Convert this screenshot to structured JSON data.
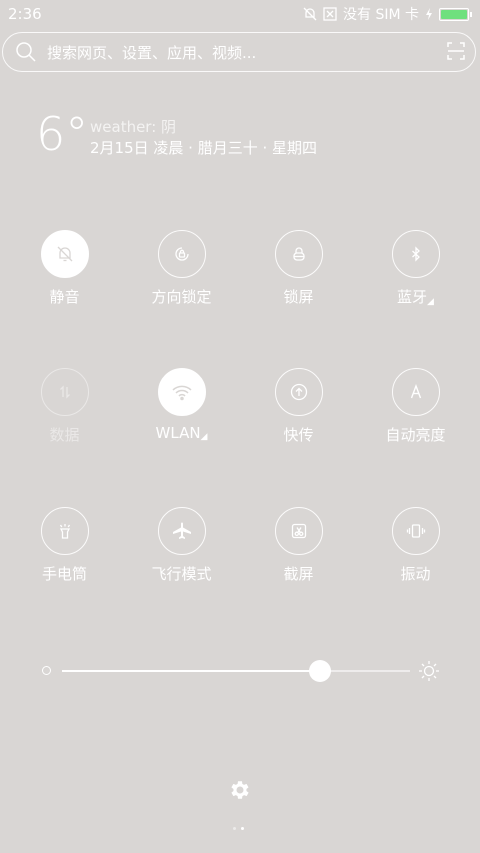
{
  "status": {
    "time": "2:36",
    "sim_text": "没有 SIM 卡",
    "battery_level": 1.0,
    "battery_color": "#6fe07e"
  },
  "search": {
    "placeholder": "搜索网页、设置、应用、视频..."
  },
  "weather": {
    "temp": "6°",
    "desc": "weather: 阴",
    "date": "2月15日 凌晨 · 腊月三十 · 星期四"
  },
  "tiles": [
    {
      "label": "静音",
      "icon": "bell-off-icon",
      "state": "active"
    },
    {
      "label": "方向锁定",
      "icon": "rotation-lock-icon",
      "state": "off"
    },
    {
      "label": "锁屏",
      "icon": "lock-icon",
      "state": "off"
    },
    {
      "label": "蓝牙",
      "icon": "bluetooth-icon",
      "state": "off",
      "has_arrow": true
    },
    {
      "label": "数据",
      "icon": "data-icon",
      "state": "disabled"
    },
    {
      "label": "WLAN",
      "icon": "wifi-icon",
      "state": "active",
      "has_arrow": true
    },
    {
      "label": "快传",
      "icon": "quick-transfer-icon",
      "state": "off"
    },
    {
      "label": "自动亮度",
      "icon": "auto-brightness-icon",
      "state": "off"
    },
    {
      "label": "手电筒",
      "icon": "flashlight-icon",
      "state": "off"
    },
    {
      "label": "飞行模式",
      "icon": "airplane-icon",
      "state": "off"
    },
    {
      "label": "截屏",
      "icon": "screenshot-icon",
      "state": "off"
    },
    {
      "label": "振动",
      "icon": "vibrate-icon",
      "state": "off"
    }
  ],
  "brightness": {
    "level": 0.74
  },
  "pager": {
    "pages": 2,
    "current": 2
  }
}
